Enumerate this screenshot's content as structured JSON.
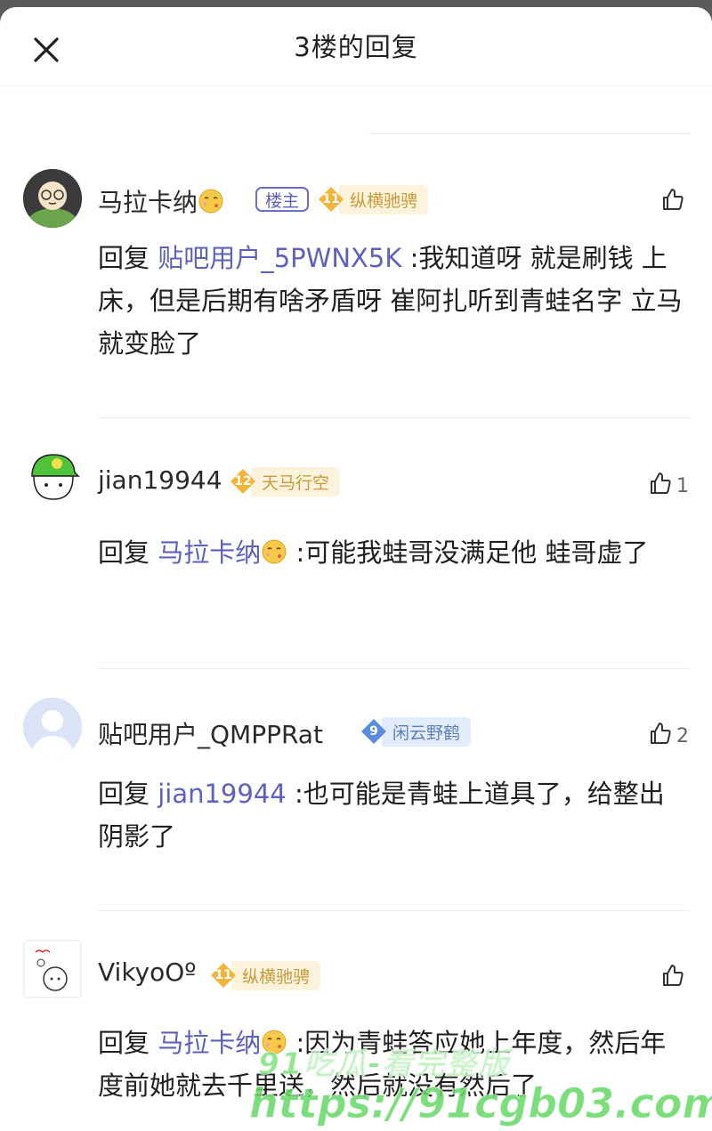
{
  "header": {
    "title": "3楼的回复"
  },
  "posts": [
    {
      "username": "马拉卡纳",
      "owner_tag": "楼主",
      "level": "11",
      "level_title": "纵横驰骋",
      "likes": "",
      "reply_prefix": "回复 ",
      "reply_to": "贴吧用户_5PWNX5K",
      "text": " :我知道呀 就是刷钱 上床，但是后期有啥矛盾呀 崔阿扎听到青蛙名字 立马就变脸了"
    },
    {
      "username": "jian19944",
      "level": "12",
      "level_title": "天马行空",
      "likes": "1",
      "reply_prefix": "回复 ",
      "reply_to": "马拉卡纳",
      "text": " :可能我蛙哥没满足他 蛙哥虚了"
    },
    {
      "username": "贴吧用户_QMPPRat",
      "level": "9",
      "level_title": "闲云野鹤",
      "likes": "2",
      "reply_prefix": "回复 ",
      "reply_to": "jian19944",
      "text": " :也可能是青蛙上道具了，给整出阴影了"
    },
    {
      "username": "VikyoOº",
      "level": "11",
      "level_title": "纵横驰骋",
      "likes": "",
      "reply_prefix": "回复 ",
      "reply_to": "马拉卡纳",
      "text": " :因为青蛙答应她上年度，然后年度前她就去千里送，然后就没有然后了"
    }
  ],
  "watermark": {
    "line1": "91吃瓜-看完整版",
    "line2": "https://91cgb03.com"
  },
  "colors": {
    "mention": "#5d61bd",
    "gold_badge": "#f2b43a",
    "blue_badge": "#5b8ce0"
  }
}
